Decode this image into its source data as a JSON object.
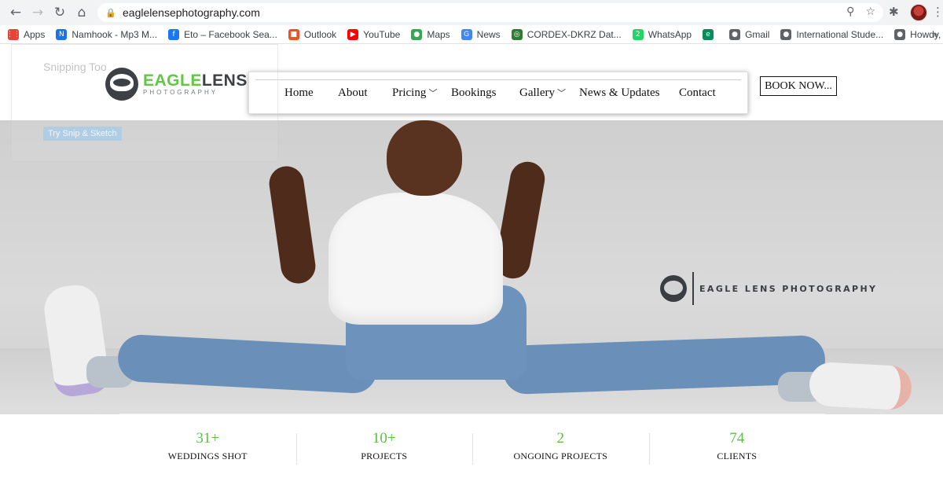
{
  "browser": {
    "url": "eaglelensephotography.com",
    "bookmarks": [
      {
        "label": "Apps",
        "icon": "apps-grid-icon",
        "color": "#ea4335"
      },
      {
        "label": "Namhook - Mp3 M...",
        "icon": "namhook-icon",
        "color": "#1a73e8"
      },
      {
        "label": "Eto – Facebook Sea...",
        "icon": "facebook-icon",
        "color": "#1877f2"
      },
      {
        "label": "Outlook",
        "icon": "microsoft-icon",
        "color": "#f25022"
      },
      {
        "label": "YouTube",
        "icon": "youtube-icon",
        "color": "#ff0000"
      },
      {
        "label": "Maps",
        "icon": "maps-icon",
        "color": "#34a853"
      },
      {
        "label": "News",
        "icon": "news-icon",
        "color": "#4285f4"
      },
      {
        "label": "CORDEX-DKRZ Dat...",
        "icon": "cordex-icon",
        "color": "#2e7d32"
      },
      {
        "label": "WhatsApp",
        "icon": "whatsapp-icon",
        "color": "#25d366"
      },
      {
        "label": "",
        "icon": "edge-icon",
        "color": "#0c8a5a"
      },
      {
        "label": "Gmail",
        "icon": "globe-icon",
        "color": "#5f6368"
      },
      {
        "label": "International Stude...",
        "icon": "globe-icon",
        "color": "#5f6368"
      },
      {
        "label": "Howdy, Admin",
        "icon": "globe-icon",
        "color": "#5f6368"
      }
    ]
  },
  "ghost_popup": {
    "title": "Snipping Too",
    "button": "Try Snip & Sketch"
  },
  "header": {
    "logo": {
      "eagle": "EAGLE",
      "lens": "LENS",
      "sub": "PHOTOGRAPHY"
    },
    "nav": [
      {
        "label": "Home"
      },
      {
        "label": "About"
      },
      {
        "label": "Pricing",
        "has_dropdown": true
      },
      {
        "label": "Bookings"
      },
      {
        "label": "Gallery",
        "has_dropdown": true
      },
      {
        "label": "News & Updates"
      },
      {
        "label": "Contact"
      }
    ],
    "book_button": "BOOK NOW..."
  },
  "hero": {
    "watermark": "EAGLE LENS PHOTOGRAPHY"
  },
  "stats": [
    {
      "value": "31+",
      "label": "WEDDINGS SHOT"
    },
    {
      "value": "10+",
      "label": "PROJECTS"
    },
    {
      "value": "2",
      "label": "ONGOING PROJECTS"
    },
    {
      "value": "74",
      "label": "CLIENTS"
    }
  ],
  "colors": {
    "accent_green": "#57c33d",
    "logo_dark": "#2d3136"
  }
}
